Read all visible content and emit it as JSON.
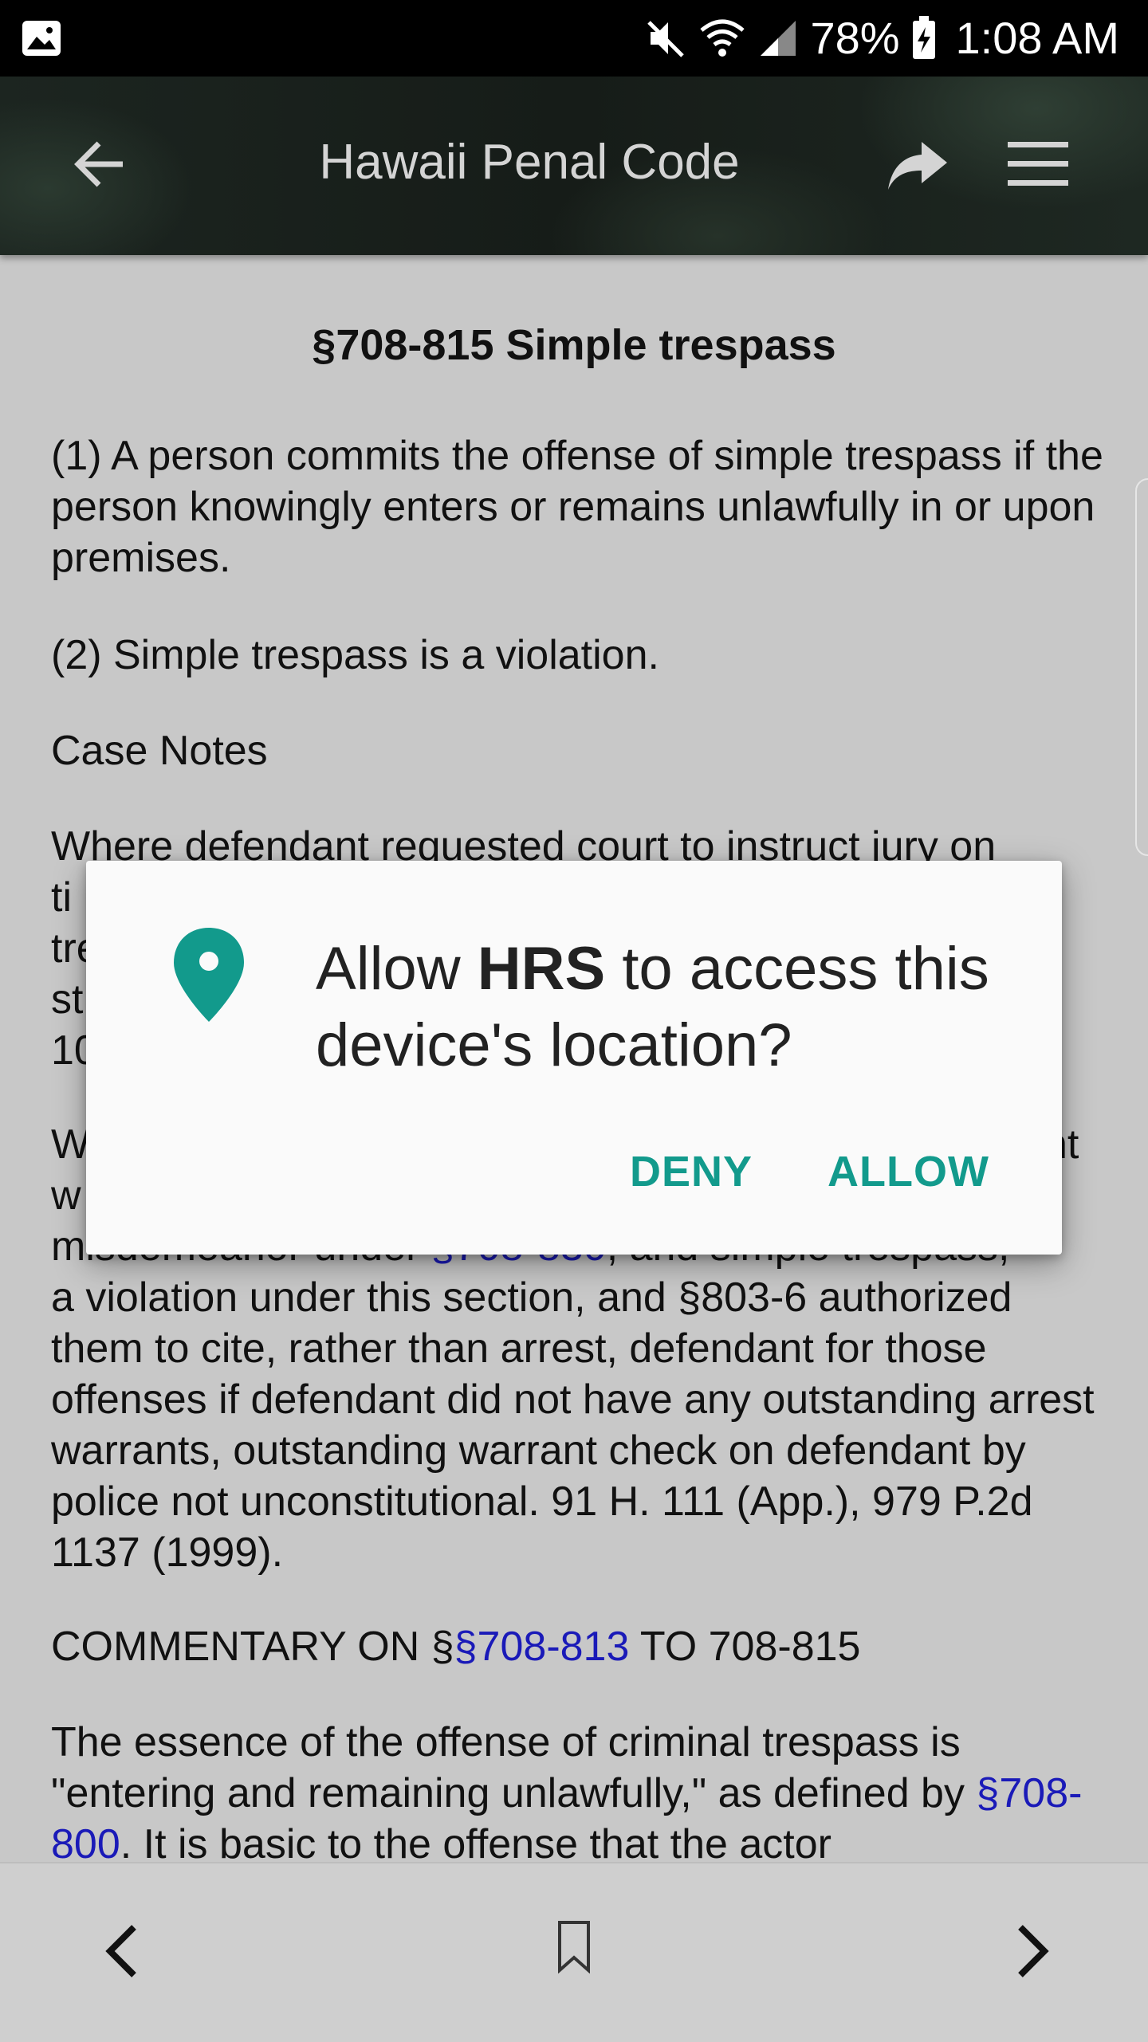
{
  "status_bar": {
    "battery_percent": "78%",
    "time": "1:08 AM",
    "icons": [
      "gallery-icon",
      "mute-icon",
      "wifi-icon",
      "signal-icon",
      "battery-charging-icon"
    ]
  },
  "app_bar": {
    "title": "Hawaii Penal Code",
    "icons": [
      "back-arrow-icon",
      "share-icon",
      "menu-icon"
    ]
  },
  "content": {
    "heading": "§708-815 Simple trespass",
    "p1": "(1) A person commits the offense of simple trespass if the person knowingly enters or remains unlawfully in or upon premises.",
    "p2": "(2) Simple trespass is a violation.",
    "p3": "Case Notes",
    "p4_visible_line": "Where defendant requested court to instruct jury on",
    "p4_left_fragments": [
      "ti",
      "tre",
      "st",
      "10"
    ],
    "p5_line1_left": "W",
    "p5_line1_right": "nt",
    "p5_line2_left": "w",
    "p5_line3_partial_a": "misdemeanor under ",
    "p5_line3_link": "§708-830",
    "p5_line3_partial_b": ", and simple trespass,",
    "p5_rest": "a violation under this section, and §803-6 authorized them to cite, rather than arrest, defendant for those offenses if defendant did not have any outstanding arrest warrants, outstanding warrant check on defendant by police not unconstitutional. 91 H. 111 (App.), 979 P.2d 1137 (1999).",
    "p6_prefix": "COMMENTARY ON §",
    "p6_link": "§708-813",
    "p6_suffix": " TO 708-815",
    "p7_text": "The essence of the offense of criminal trespass is \"entering and remaining unlawfully,\" as defined by ",
    "p7_link": "§708-800",
    "p7_suffix": ". It is basic to the offense that the actor"
  },
  "dialog": {
    "msg_prefix": "Allow ",
    "msg_app": "HRS",
    "msg_suffix": " to access this device's location?",
    "deny_label": "DENY",
    "allow_label": "ALLOW",
    "icon": "location-pin-icon",
    "accent_color": "#129a8c"
  },
  "bottom_bar": {
    "icons": [
      "chevron-left-icon",
      "bookmark-icon",
      "chevron-right-icon"
    ]
  }
}
